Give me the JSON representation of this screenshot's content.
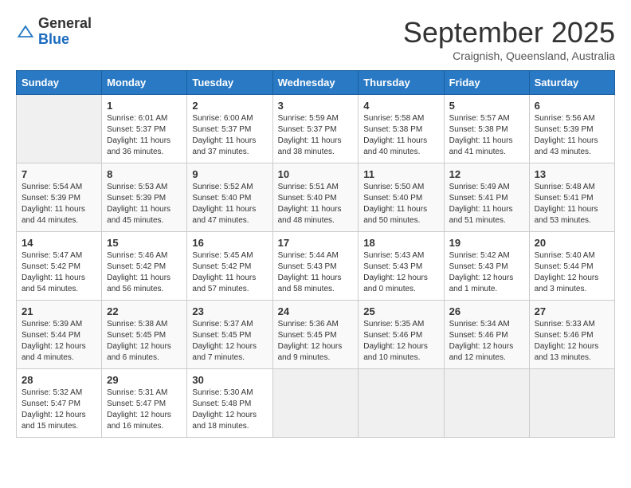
{
  "header": {
    "logo_line1": "General",
    "logo_line2": "Blue",
    "month": "September 2025",
    "location": "Craignish, Queensland, Australia"
  },
  "days_of_week": [
    "Sunday",
    "Monday",
    "Tuesday",
    "Wednesday",
    "Thursday",
    "Friday",
    "Saturday"
  ],
  "weeks": [
    [
      {
        "day": "",
        "info": ""
      },
      {
        "day": "1",
        "info": "Sunrise: 6:01 AM\nSunset: 5:37 PM\nDaylight: 11 hours\nand 36 minutes."
      },
      {
        "day": "2",
        "info": "Sunrise: 6:00 AM\nSunset: 5:37 PM\nDaylight: 11 hours\nand 37 minutes."
      },
      {
        "day": "3",
        "info": "Sunrise: 5:59 AM\nSunset: 5:37 PM\nDaylight: 11 hours\nand 38 minutes."
      },
      {
        "day": "4",
        "info": "Sunrise: 5:58 AM\nSunset: 5:38 PM\nDaylight: 11 hours\nand 40 minutes."
      },
      {
        "day": "5",
        "info": "Sunrise: 5:57 AM\nSunset: 5:38 PM\nDaylight: 11 hours\nand 41 minutes."
      },
      {
        "day": "6",
        "info": "Sunrise: 5:56 AM\nSunset: 5:39 PM\nDaylight: 11 hours\nand 43 minutes."
      }
    ],
    [
      {
        "day": "7",
        "info": "Sunrise: 5:54 AM\nSunset: 5:39 PM\nDaylight: 11 hours\nand 44 minutes."
      },
      {
        "day": "8",
        "info": "Sunrise: 5:53 AM\nSunset: 5:39 PM\nDaylight: 11 hours\nand 45 minutes."
      },
      {
        "day": "9",
        "info": "Sunrise: 5:52 AM\nSunset: 5:40 PM\nDaylight: 11 hours\nand 47 minutes."
      },
      {
        "day": "10",
        "info": "Sunrise: 5:51 AM\nSunset: 5:40 PM\nDaylight: 11 hours\nand 48 minutes."
      },
      {
        "day": "11",
        "info": "Sunrise: 5:50 AM\nSunset: 5:40 PM\nDaylight: 11 hours\nand 50 minutes."
      },
      {
        "day": "12",
        "info": "Sunrise: 5:49 AM\nSunset: 5:41 PM\nDaylight: 11 hours\nand 51 minutes."
      },
      {
        "day": "13",
        "info": "Sunrise: 5:48 AM\nSunset: 5:41 PM\nDaylight: 11 hours\nand 53 minutes."
      }
    ],
    [
      {
        "day": "14",
        "info": "Sunrise: 5:47 AM\nSunset: 5:42 PM\nDaylight: 11 hours\nand 54 minutes."
      },
      {
        "day": "15",
        "info": "Sunrise: 5:46 AM\nSunset: 5:42 PM\nDaylight: 11 hours\nand 56 minutes."
      },
      {
        "day": "16",
        "info": "Sunrise: 5:45 AM\nSunset: 5:42 PM\nDaylight: 11 hours\nand 57 minutes."
      },
      {
        "day": "17",
        "info": "Sunrise: 5:44 AM\nSunset: 5:43 PM\nDaylight: 11 hours\nand 58 minutes."
      },
      {
        "day": "18",
        "info": "Sunrise: 5:43 AM\nSunset: 5:43 PM\nDaylight: 12 hours\nand 0 minutes."
      },
      {
        "day": "19",
        "info": "Sunrise: 5:42 AM\nSunset: 5:43 PM\nDaylight: 12 hours\nand 1 minute."
      },
      {
        "day": "20",
        "info": "Sunrise: 5:40 AM\nSunset: 5:44 PM\nDaylight: 12 hours\nand 3 minutes."
      }
    ],
    [
      {
        "day": "21",
        "info": "Sunrise: 5:39 AM\nSunset: 5:44 PM\nDaylight: 12 hours\nand 4 minutes."
      },
      {
        "day": "22",
        "info": "Sunrise: 5:38 AM\nSunset: 5:45 PM\nDaylight: 12 hours\nand 6 minutes."
      },
      {
        "day": "23",
        "info": "Sunrise: 5:37 AM\nSunset: 5:45 PM\nDaylight: 12 hours\nand 7 minutes."
      },
      {
        "day": "24",
        "info": "Sunrise: 5:36 AM\nSunset: 5:45 PM\nDaylight: 12 hours\nand 9 minutes."
      },
      {
        "day": "25",
        "info": "Sunrise: 5:35 AM\nSunset: 5:46 PM\nDaylight: 12 hours\nand 10 minutes."
      },
      {
        "day": "26",
        "info": "Sunrise: 5:34 AM\nSunset: 5:46 PM\nDaylight: 12 hours\nand 12 minutes."
      },
      {
        "day": "27",
        "info": "Sunrise: 5:33 AM\nSunset: 5:46 PM\nDaylight: 12 hours\nand 13 minutes."
      }
    ],
    [
      {
        "day": "28",
        "info": "Sunrise: 5:32 AM\nSunset: 5:47 PM\nDaylight: 12 hours\nand 15 minutes."
      },
      {
        "day": "29",
        "info": "Sunrise: 5:31 AM\nSunset: 5:47 PM\nDaylight: 12 hours\nand 16 minutes."
      },
      {
        "day": "30",
        "info": "Sunrise: 5:30 AM\nSunset: 5:48 PM\nDaylight: 12 hours\nand 18 minutes."
      },
      {
        "day": "",
        "info": ""
      },
      {
        "day": "",
        "info": ""
      },
      {
        "day": "",
        "info": ""
      },
      {
        "day": "",
        "info": ""
      }
    ]
  ]
}
